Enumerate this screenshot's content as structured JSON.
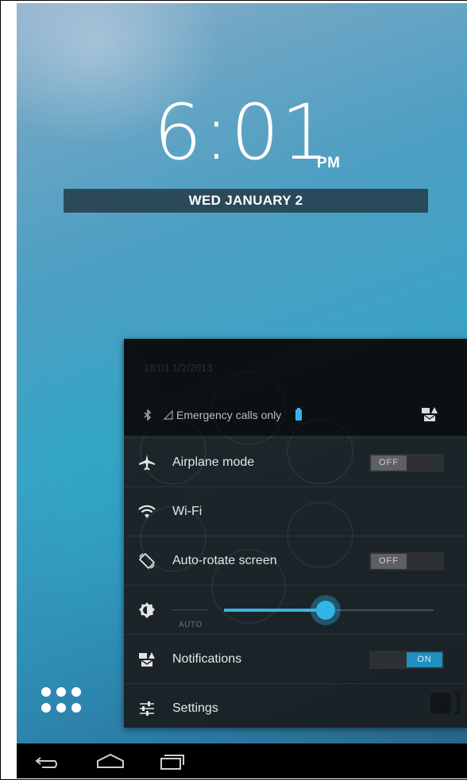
{
  "lockscreen": {
    "time": "6:01",
    "ampm": "PM",
    "date": "WED JANUARY 2"
  },
  "panel": {
    "datetime": "18:01  1/2/2013",
    "status_text": "Emergency calls only",
    "rows": [
      {
        "label": "Airplane mode",
        "icon": "airplane-icon",
        "toggle": "OFF"
      },
      {
        "label": "Wi-Fi",
        "icon": "wifi-icon"
      },
      {
        "label": "Auto-rotate screen",
        "icon": "auto-rotate-icon",
        "toggle": "OFF"
      },
      {
        "label": "Notifications",
        "icon": "notifications-icon",
        "toggle": "ON"
      },
      {
        "label": "Settings",
        "icon": "settings-sliders-icon"
      }
    ],
    "brightness": {
      "auto_label": "AUTO",
      "level": 0.48
    }
  },
  "colors": {
    "accent": "#33b5e5",
    "panel_bg": "#1c1f21"
  }
}
